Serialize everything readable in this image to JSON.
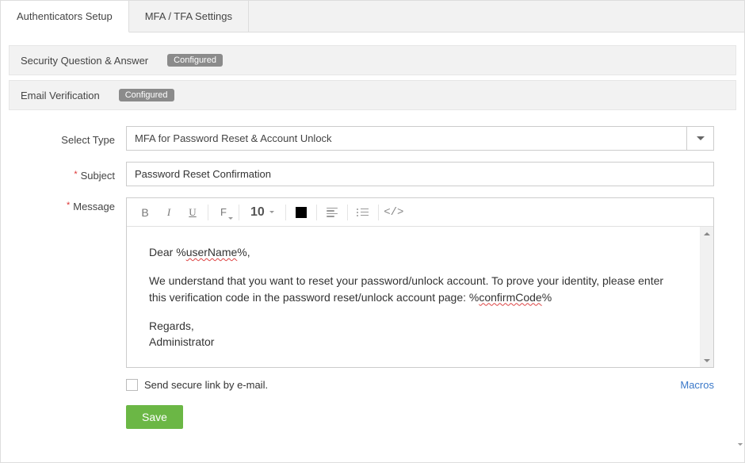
{
  "tabs": {
    "authenticators": "Authenticators Setup",
    "mfa": "MFA / TFA Settings"
  },
  "sections": {
    "sq": {
      "title": "Security Question & Answer",
      "badge": "Configured"
    },
    "email": {
      "title": "Email Verification",
      "badge": "Configured"
    }
  },
  "labels": {
    "select_type": "Select Type",
    "subject": "Subject",
    "message": "Message",
    "secure_link": "Send secure link by e-mail.",
    "macros": "Macros",
    "save": "Save"
  },
  "select_type_value": "MFA for Password Reset & Account Unlock",
  "subject_value": "Password Reset Confirmation",
  "font_size": "10",
  "message": {
    "greeting_pre": "Dear %",
    "greeting_var": "userName",
    "greeting_post": "%,",
    "body_pre": "We understand that you want to reset your password/unlock account. To prove your identity, please enter this verification code in the password reset/unlock account page: %",
    "body_var": "confirmCode",
    "body_post": "%",
    "regards": "Regards,",
    "sign": "Administrator"
  }
}
